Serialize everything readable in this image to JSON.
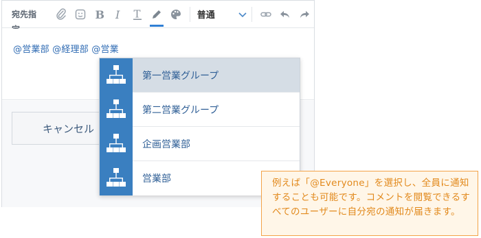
{
  "toolbar": {
    "recipient_label": "宛先指定",
    "format_value": "普通",
    "icons": [
      "attachment-icon",
      "emoji-icon",
      "bold-icon",
      "italic-icon",
      "underline-icon",
      "pen-icon",
      "palette-icon",
      "chevron-down-icon",
      "link-icon",
      "undo-icon",
      "redo-icon"
    ],
    "accent_color": "#2f7fd4"
  },
  "editor": {
    "mentions_text": "@営業部  @経理部  @営業"
  },
  "buttons": {
    "cancel_label": "キャンセル"
  },
  "dropdown": {
    "items": [
      {
        "label": "第一営業グループ",
        "icon": "group-icon",
        "selected": true
      },
      {
        "label": "第二営業グループ",
        "icon": "group-icon",
        "selected": false
      },
      {
        "label": "企画営業部",
        "icon": "group-icon",
        "selected": false
      },
      {
        "label": "営業部",
        "icon": "group-icon",
        "selected": false
      }
    ],
    "icon_bg_color": "#3a7fc0",
    "selected_bg_color": "#d5dde5"
  },
  "note": {
    "text": "例えば「@Everyone」を選択し、全員に通知することも可能です。コメントを閲覧できるすべてのユーザーに自分宛の通知が届きます。",
    "border_color": "#f3a246",
    "text_color": "#e2891c"
  }
}
